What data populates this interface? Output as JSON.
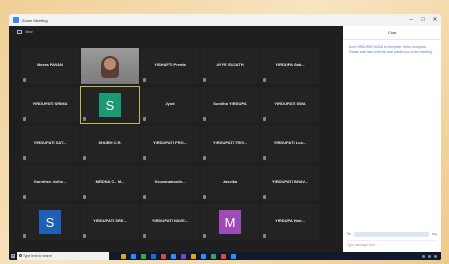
{
  "window": {
    "title": "Zoom Meeting",
    "controls": [
      "–",
      "□",
      "✕"
    ]
  },
  "meeting": {
    "view_label": "View"
  },
  "tiles": [
    {
      "name": "Meera PAVAN",
      "type": "name"
    },
    {
      "name": "",
      "type": "video"
    },
    {
      "name": "YISHAFTI Preeta",
      "type": "name"
    },
    {
      "name": "AYYE SUJATH",
      "type": "name"
    },
    {
      "name": "YIRDUPA Sab...",
      "type": "name"
    },
    {
      "name": "YIRDUPATI SRIMA",
      "type": "name"
    },
    {
      "name": "S",
      "type": "avatar",
      "color": "#1a9a72",
      "speaking": true
    },
    {
      "name": "Jyoti",
      "type": "name"
    },
    {
      "name": "Sunitha YIRDUPA",
      "type": "name"
    },
    {
      "name": "YIRDUPATI SWA",
      "type": "name"
    },
    {
      "name": "YIRDUPATI SAT...",
      "type": "name"
    },
    {
      "name": "SHUBH C.R.",
      "type": "name"
    },
    {
      "name": "YIRDUPATI PRO...",
      "type": "name"
    },
    {
      "name": "YIRDUPATI TRIV...",
      "type": "name"
    },
    {
      "name": "YIRDUPATI Lux...",
      "type": "name"
    },
    {
      "name": "Garnthee Jothe...",
      "type": "name"
    },
    {
      "name": "MRDNA C.. M...",
      "type": "name"
    },
    {
      "name": "Ssuvanabooth...",
      "type": "name"
    },
    {
      "name": "Jasvika",
      "type": "name"
    },
    {
      "name": "YIRDUPATI BHAV...",
      "type": "name"
    },
    {
      "name": "S",
      "type": "avatar",
      "color": "#1f5fb8"
    },
    {
      "name": "YIRDUPATI SRE...",
      "type": "name"
    },
    {
      "name": "YIRDUPATI NAVE...",
      "type": "name"
    },
    {
      "name": "M",
      "type": "avatar",
      "color": "#a04ab8"
    },
    {
      "name": "YIRDUPA Hari...",
      "type": "name"
    }
  ],
  "chat": {
    "header": "Chat",
    "message": "from YIRDUPATI ANKA to everyone: Hello, everyone. Please wait here until the host admits you to the meeting.",
    "to_label": "To:",
    "to_value": "Everyone",
    "file_label": "File",
    "input_placeholder": "Type message here..."
  },
  "taskbar": {
    "search_placeholder": "Type here to search",
    "app_colors": [
      "#e0a623",
      "#2d8cff",
      "#3ba55c",
      "#1f6fd1",
      "#d94f3d",
      "#2d8cff",
      "#6b4fbb",
      "#e0a623",
      "#2d8cff",
      "#3ba55c",
      "#d94f3d",
      "#2d8cff"
    ]
  }
}
